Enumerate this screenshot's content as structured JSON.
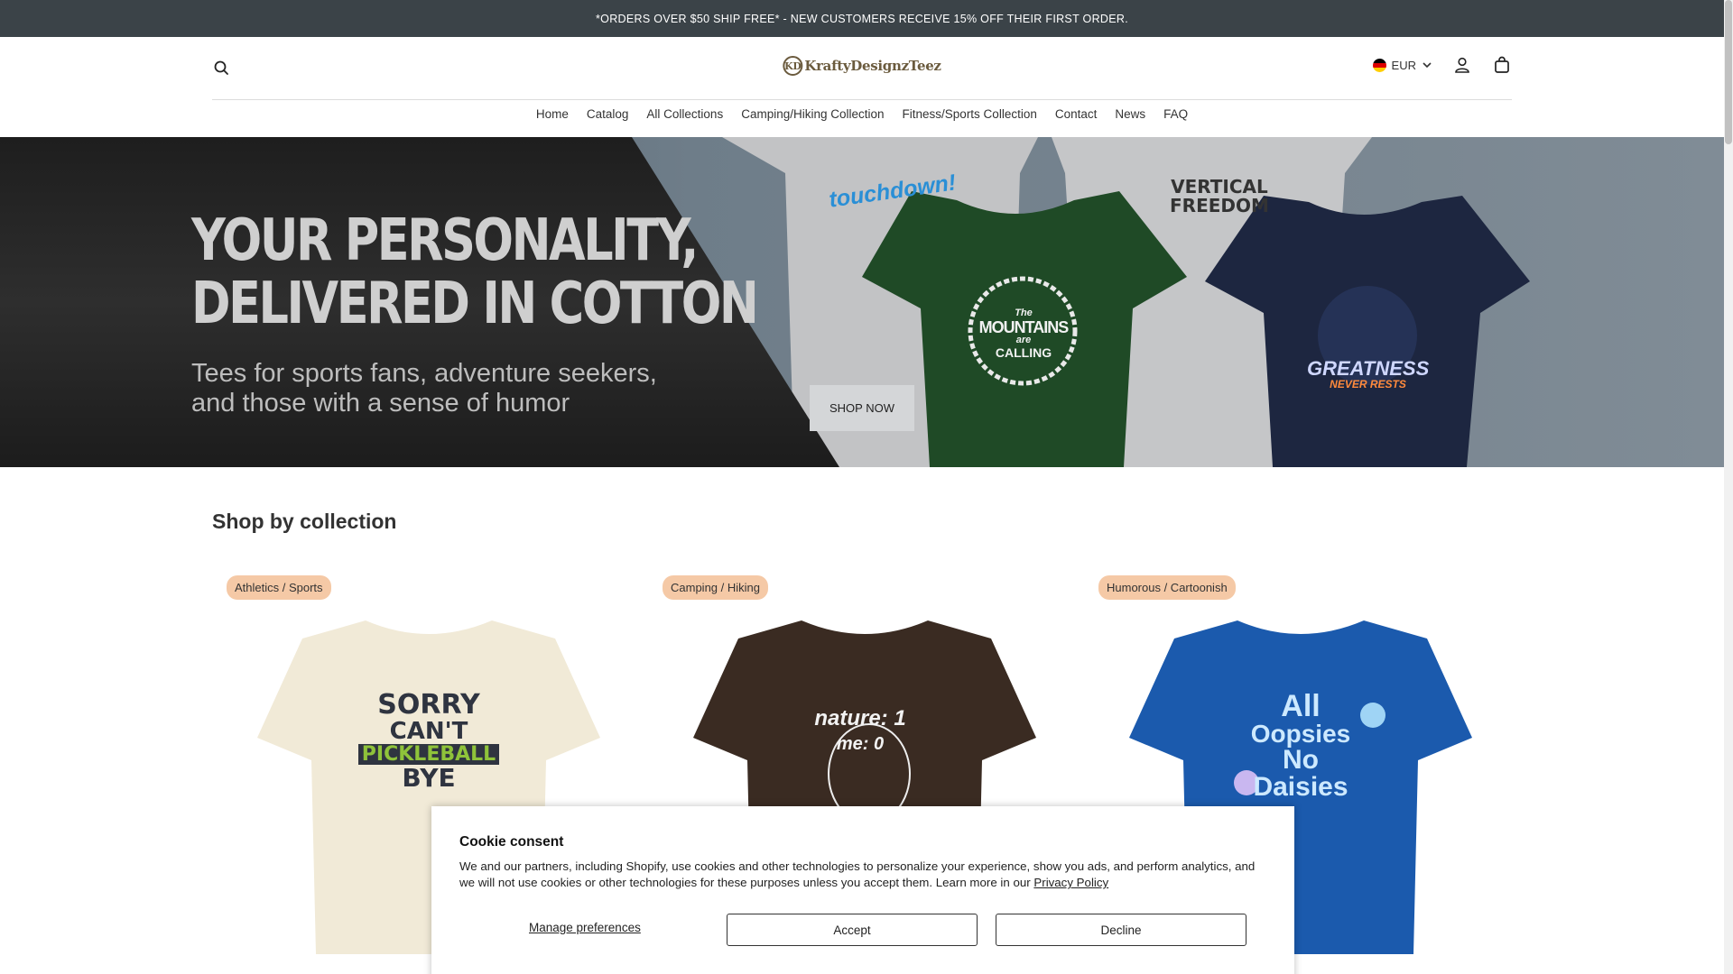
{
  "announcement": {
    "text": "*ORDERS OVER $50 SHIP FREE* - NEW CUSTOMERS RECEIVE 15% OFF THEIR FIRST ORDER."
  },
  "header": {
    "logo_text": "KraftyDesignzTeez",
    "logo_mark": "KD",
    "currency": "EUR",
    "icons": [
      "search-icon",
      "flag-icon",
      "chevron-down-icon",
      "account-icon",
      "cart-icon"
    ]
  },
  "nav": {
    "items": [
      {
        "label": "Home"
      },
      {
        "label": "Catalog"
      },
      {
        "label": "All Collections"
      },
      {
        "label": "Camping/Hiking Collection"
      },
      {
        "label": "Fitness/Sports Collection"
      },
      {
        "label": "Contact"
      },
      {
        "label": "News"
      },
      {
        "label": "FAQ"
      }
    ]
  },
  "hero": {
    "title_line1": "YOUR PERSONALITY,",
    "title_line2": "DELIVERED IN COTTON",
    "subtitle_line1": "Tees for sports fans, adventure seekers,",
    "subtitle_line2": "and those with a sense of humor",
    "cta": "SHOP NOW",
    "shirts": [
      {
        "text1": "touchdown!",
        "color": "#c2c3c5"
      },
      {
        "text1": "The",
        "text2": "MOUNTAINS",
        "text3": "are",
        "text4": "CALLING",
        "color": "#1f4a26"
      },
      {
        "text1": "VERTICAL",
        "text2": "FREEDOM",
        "color": "#c2c3c5"
      },
      {
        "text1": "GREATNESS",
        "text2": "NEVER RESTS",
        "color": "#1d2640"
      }
    ]
  },
  "collections": {
    "title": "Shop by collection",
    "items": [
      {
        "badge": "Athletics / Sports",
        "shirt_color": "#f1ead7",
        "art": [
          "SORRY",
          "CAN'T",
          "PICKLEBALL",
          "BYE"
        ]
      },
      {
        "badge": "Camping / Hiking",
        "shirt_color": "#3a2b22",
        "art": [
          "nature: 1",
          "me: 0"
        ]
      },
      {
        "badge": "Humorous / Cartoonish",
        "shirt_color": "#1b5aad",
        "art": [
          "All",
          "Oopsies",
          "No",
          "Daisies"
        ]
      }
    ]
  },
  "cookie": {
    "title": "Cookie consent",
    "text": "We and our partners, including Shopify, use cookies and other technologies to personalize your experience, show you ads, and perform analytics, and we will not use cookies or other technologies for these purposes unless you accept them. Learn more in our ",
    "link": "Privacy Policy",
    "manage": "Manage preferences",
    "accept": "Accept",
    "decline": "Decline"
  }
}
